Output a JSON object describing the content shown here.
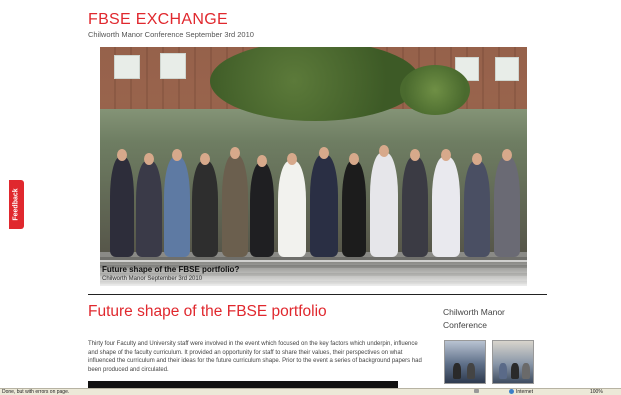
{
  "feedback": {
    "label": "Feedback"
  },
  "header": {
    "title": "FBSE EXCHANGE",
    "subtitle": "Chilworth Manor Conference September 3rd 2010"
  },
  "hero": {
    "caption_title": "Future shape of the FBSE portfolio?",
    "caption_sub": "Chilworth Manor September 3rd 2010",
    "image_description_icon": "group-photo"
  },
  "article": {
    "title": "Future shape of the FBSE portfolio",
    "body": "Thirty four Faculty and University staff were involved in the event which focused on the key factors which underpin, influence and shape of the faculty curriculum. It provided an opportunity for staff to share their values, their perspectives on what influenced the curriculum and their ideas for the future curriculum shape. Prior to the event a series of background papers had been produced and circulated."
  },
  "sidebar": {
    "title": "Chilworth Manor Conference"
  },
  "statusbar": {
    "left": "Done, but with errors on page.",
    "zone": "Internet",
    "zoom": "100%"
  },
  "colors": {
    "accent": "#e0282e",
    "text": "#444444"
  }
}
